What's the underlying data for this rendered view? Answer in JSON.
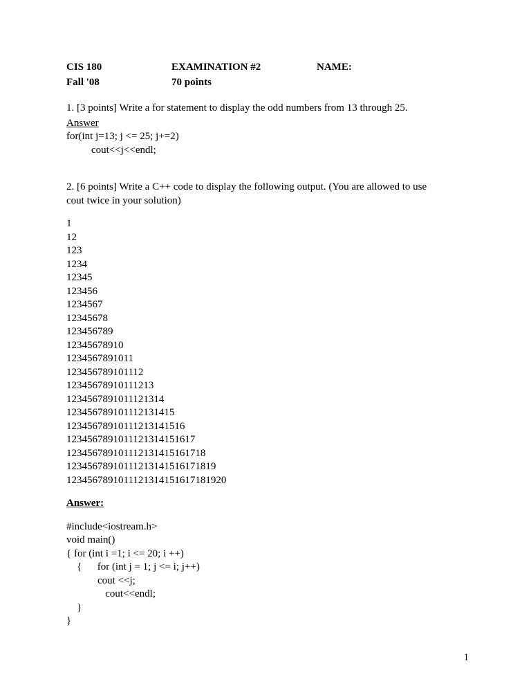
{
  "header": {
    "course": "CIS 180",
    "exam": "EXAMINATION #2",
    "name_label": "NAME:",
    "term": "Fall '08",
    "points": "70 points"
  },
  "q1": {
    "prompt": "1. [3 points]  Write a for statement to display the odd numbers from 13 through 25.",
    "answer_label": "Answer",
    "code_line1": "for(int j=13; j <= 25; j+=2)",
    "code_line2": "cout<<j<<endl;"
  },
  "q2": {
    "prompt_line1": "2. [6 points] Write a C++ code to display the following output. (You are allowed to use",
    "prompt_line2": "cout twice in your solution)",
    "output": [
      "1",
      "12",
      "123",
      "1234",
      "12345",
      "123456",
      "1234567",
      "12345678",
      "123456789",
      "12345678910",
      "1234567891011",
      "123456789101112",
      "12345678910111213",
      "1234567891011121314",
      "123456789101112131415",
      "12345678910111213141516",
      "1234567891011121314151617",
      "123456789101112131415161718",
      "12345678910111213141516171819",
      "1234567891011121314151617181920"
    ],
    "answer_label": "Answer:",
    "code": [
      "#include<iostream.h>",
      "void main()",
      "{ for (int i =1; i <= 20; i ++)",
      "    {      for (int j = 1; j <= i; j++)",
      "            cout <<j;",
      "               cout<<endl;",
      "    }",
      "}"
    ]
  },
  "page_number": "1"
}
